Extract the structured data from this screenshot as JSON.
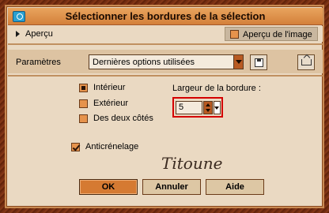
{
  "window": {
    "title": "Sélectionner les bordures de la sélection",
    "app_icon": "camera-icon"
  },
  "preview": {
    "toggle_label": "Aperçu",
    "image_preview_label": "Aperçu de l'image",
    "image_preview_checked": false
  },
  "parameters": {
    "label": "Paramètres",
    "preset_value": "Dernières options utilisées",
    "save_icon": "save-icon",
    "reset_icon": "reset-icon"
  },
  "options": {
    "interior_label": "Intérieur",
    "interior_selected": true,
    "exterior_label": "Extérieur",
    "exterior_selected": false,
    "both_label": "Des deux côtés",
    "both_selected": false
  },
  "border_width": {
    "label": "Largeur de la bordure :",
    "value": "5"
  },
  "antialias": {
    "label": "Anticrénelage",
    "checked": true
  },
  "signature": "Titoune",
  "buttons": {
    "ok": "OK",
    "cancel": "Annuler",
    "help": "Aide"
  },
  "colors": {
    "accent": "#d57a32",
    "title_bar": "#e09050",
    "background": "#ead9c2",
    "highlight_border": "#d40000"
  }
}
